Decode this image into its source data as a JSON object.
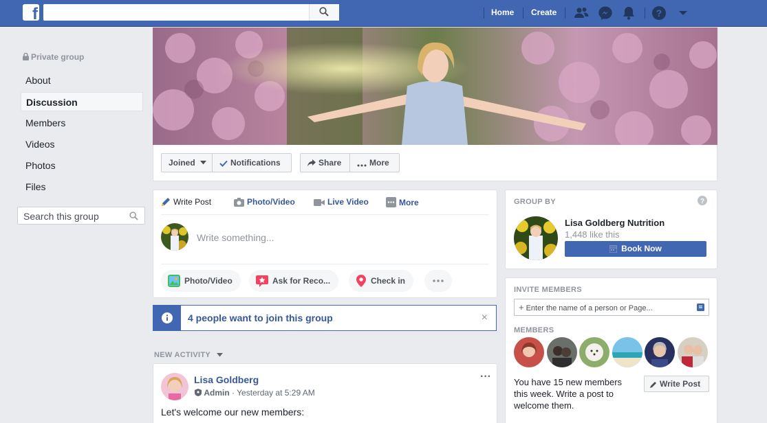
{
  "topbar": {
    "logo": "f",
    "search_placeholder": "",
    "nav": [
      "Home",
      "Create"
    ],
    "icons": [
      "friend-requests-icon",
      "messenger-icon",
      "notifications-icon",
      "help-icon",
      "account-menu-icon"
    ]
  },
  "sidebar": {
    "privacy": "Private group",
    "items": [
      {
        "label": "About"
      },
      {
        "label": "Discussion",
        "active": true
      },
      {
        "label": "Members"
      },
      {
        "label": "Videos"
      },
      {
        "label": "Photos"
      },
      {
        "label": "Files"
      }
    ],
    "search_placeholder": "Search this group"
  },
  "cover": {
    "buttons": {
      "joined": "Joined",
      "notifications": "Notifications",
      "share": "Share",
      "more": "More"
    }
  },
  "composer": {
    "tabs": {
      "write_post": "Write Post",
      "photo_video": "Photo/Video",
      "live_video": "Live Video",
      "more": "More"
    },
    "placeholder": "Write something...",
    "actions": {
      "photo_video": "Photo/Video",
      "ask": "Ask for Reco...",
      "check_in": "Check in"
    }
  },
  "join_requests": {
    "text": "4 people want to join this group",
    "close": "×"
  },
  "feed": {
    "section": "NEW ACTIVITY",
    "post": {
      "author": "Lisa Goldberg",
      "role": "Admin",
      "time": "Yesterday at 5:29 AM",
      "separator": "·",
      "text": "Let's welcome our new members:",
      "menu": "···"
    }
  },
  "group_by": {
    "label": "GROUP BY",
    "page_name": "Lisa Goldberg Nutrition",
    "likes": "1,448 like this",
    "cta": "Book Now"
  },
  "invite": {
    "label": "INVITE MEMBERS",
    "placeholder": "Enter the name of a person or Page...",
    "members_label": "MEMBERS",
    "message": "You have 15 new members this week. Write a post to welcome them.",
    "write_post": "Write Post"
  },
  "colors": {
    "brand": "#4267b2",
    "link": "#365899",
    "background": "#e9ebee"
  }
}
